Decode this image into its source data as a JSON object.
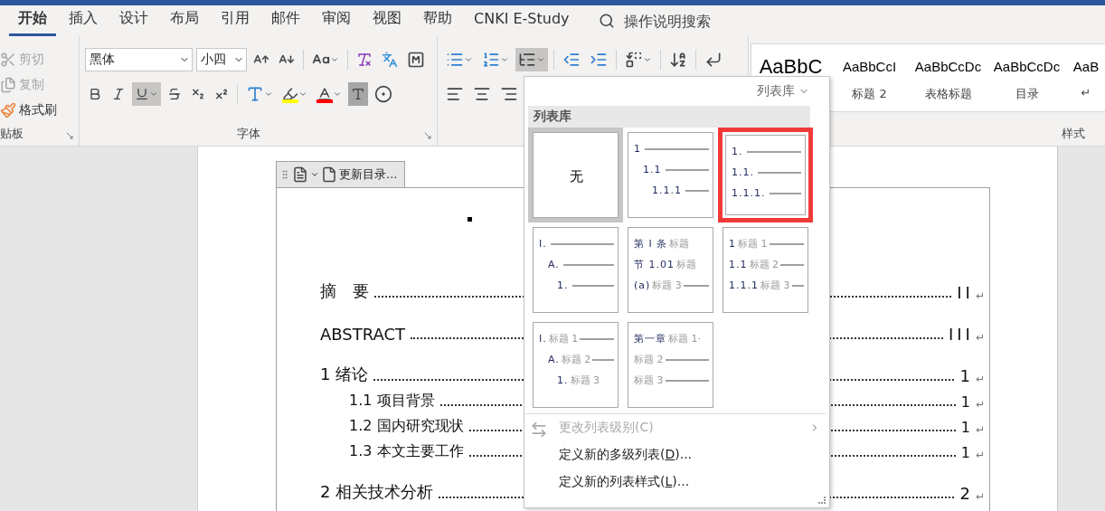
{
  "tabs": [
    {
      "label": "开始",
      "selected": true
    },
    {
      "label": "插入",
      "selected": false
    },
    {
      "label": "设计",
      "selected": false
    },
    {
      "label": "布局",
      "selected": false
    },
    {
      "label": "引用",
      "selected": false
    },
    {
      "label": "邮件",
      "selected": false
    },
    {
      "label": "审阅",
      "selected": false
    },
    {
      "label": "视图",
      "selected": false
    },
    {
      "label": "帮助",
      "selected": false
    },
    {
      "label": "CNKI E-Study",
      "selected": false
    }
  ],
  "tell_me": {
    "placeholder": "操作说明搜索"
  },
  "clipboard": {
    "label": "贴板",
    "buttons": [
      {
        "kind": "cut",
        "label": "剪切",
        "disabled": true
      },
      {
        "kind": "copy",
        "label": "复制",
        "disabled": true
      },
      {
        "kind": "painter",
        "label": "格式刷",
        "disabled": false
      }
    ]
  },
  "font": {
    "label": "字体",
    "font_name": "黑体",
    "font_size": "小四",
    "underline_pressed": true
  },
  "paragraph": {
    "multilevel_pressed": true
  },
  "styles": {
    "label": "样式",
    "items": [
      {
        "sample": "AaBbC",
        "big": true
      },
      {
        "sample": "AaBbCcI",
        "big": false,
        "caption": "标题 2"
      },
      {
        "sample": "AaBbCcDc",
        "big": false,
        "caption": "表格标题"
      },
      {
        "sample": "AaBbCcDc",
        "big": false,
        "caption": "目录"
      },
      {
        "sample": "AaB",
        "big": false,
        "caption": "↵"
      }
    ]
  },
  "toc_toolbar": {
    "update_label": "更新目录..."
  },
  "toc": [
    {
      "kind": "chapter",
      "title": "摘　要",
      "page": "II",
      "end_mark": "↵"
    },
    {
      "kind": "chapter",
      "title": "ABSTRACT",
      "page": "III",
      "end_mark": "↵"
    },
    {
      "kind": "chapter",
      "number": "1",
      "title": "绪论",
      "page": "1",
      "end_mark": "↵"
    },
    {
      "kind": "section",
      "number": "1.1",
      "title": "项目背景",
      "page": "1",
      "end_mark": "↵"
    },
    {
      "kind": "section",
      "number": "1.2",
      "title": "国内研究现状",
      "page": "1",
      "end_mark": "↵"
    },
    {
      "kind": "section",
      "number": "1.3",
      "title": "本文主要工作",
      "page": "1",
      "end_mark": "↵"
    },
    {
      "kind": "chapter",
      "number": "2",
      "title": "相关技术分析",
      "page": "2",
      "end_mark": "↵"
    }
  ],
  "list_menu": {
    "header": "列表库",
    "section": "列表库",
    "cells": [
      {
        "kind": "none",
        "label": "无",
        "selected": true,
        "highlighted": false
      },
      {
        "kind": "levels",
        "indented": true,
        "selected": false,
        "highlighted": false,
        "rows": [
          {
            "number": "1",
            "line": true
          },
          {
            "number": "1.1",
            "line": true
          },
          {
            "number": "1.1.1",
            "line": true
          }
        ]
      },
      {
        "kind": "levels",
        "indented": false,
        "selected": false,
        "highlighted": true,
        "rows": [
          {
            "number": "1.",
            "line": true
          },
          {
            "number": "1.1.",
            "line": true
          },
          {
            "number": "1.1.1.",
            "line": true
          }
        ]
      },
      {
        "kind": "levels",
        "indented": true,
        "selected": false,
        "highlighted": false,
        "rows": [
          {
            "number": "I.",
            "line": true
          },
          {
            "number": "A.",
            "line": true
          },
          {
            "number": "1.",
            "line": true
          }
        ]
      },
      {
        "kind": "levels",
        "indented": false,
        "selected": false,
        "highlighted": false,
        "rows": [
          {
            "number": "第 Ⅰ 条",
            "label": "标题",
            "line": false
          },
          {
            "number": "节 1.01",
            "label": "标题",
            "line": false
          },
          {
            "number": "(a)",
            "label": "标题 3",
            "line": true
          }
        ]
      },
      {
        "kind": "levels",
        "indented": false,
        "selected": false,
        "highlighted": false,
        "rows": [
          {
            "number": "1",
            "label": "标题 1",
            "line": true
          },
          {
            "number": "1.1",
            "label": "标题 2",
            "line": true
          },
          {
            "number": "1.1.1",
            "label": "标题 3",
            "line": true
          }
        ]
      },
      {
        "kind": "levels",
        "indented": true,
        "selected": false,
        "highlighted": false,
        "rows": [
          {
            "number": "I.",
            "label": "标题 1",
            "line": true
          },
          {
            "number": "A.",
            "label": "标题 2",
            "line": true
          },
          {
            "number": "1.",
            "label": "标题 3",
            "line": false
          }
        ]
      },
      {
        "kind": "levels",
        "indented": false,
        "selected": false,
        "highlighted": false,
        "rows": [
          {
            "number": "第一章",
            "label": "标题 1·",
            "line": false
          },
          {
            "label": "标题 2",
            "line": true
          },
          {
            "label": "标题 3",
            "line": true
          }
        ]
      }
    ],
    "items": [
      {
        "kind": "submenu",
        "label": "更改列表级别(C)",
        "disabled": true
      },
      {
        "kind": "command",
        "before": "定义新的多级列表(",
        "key": "D",
        "after": ")...",
        "disabled": false
      },
      {
        "kind": "command",
        "before": "定义新的列表样式(",
        "key": "L",
        "after": ")...",
        "disabled": false
      }
    ]
  }
}
